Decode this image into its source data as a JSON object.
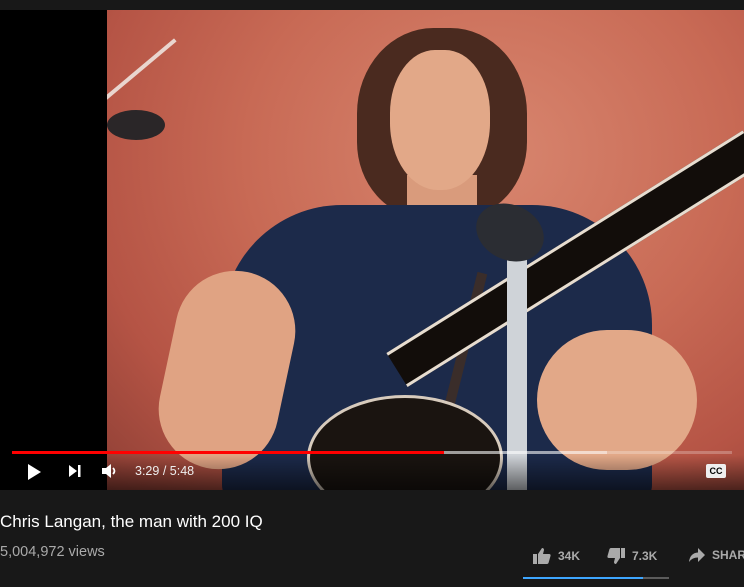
{
  "player": {
    "current_time": "3:29",
    "separator": " / ",
    "duration": "5:48",
    "progress_played": 0.6,
    "progress_loaded": 0.826,
    "icons": {
      "play": "play-icon",
      "next": "next-icon",
      "volume": "volume-icon",
      "captions": "captions-icon"
    },
    "cc_label": "CC",
    "accent_color": "#ff0000"
  },
  "video": {
    "title": "Chris Langan, the man with 200 IQ",
    "views": "5,004,972 views"
  },
  "actions": {
    "like_count": "34K",
    "dislike_count": "7.3K",
    "share_label": "SHARE",
    "like_ratio": 0.82,
    "like_color": "#3ea6ff"
  }
}
